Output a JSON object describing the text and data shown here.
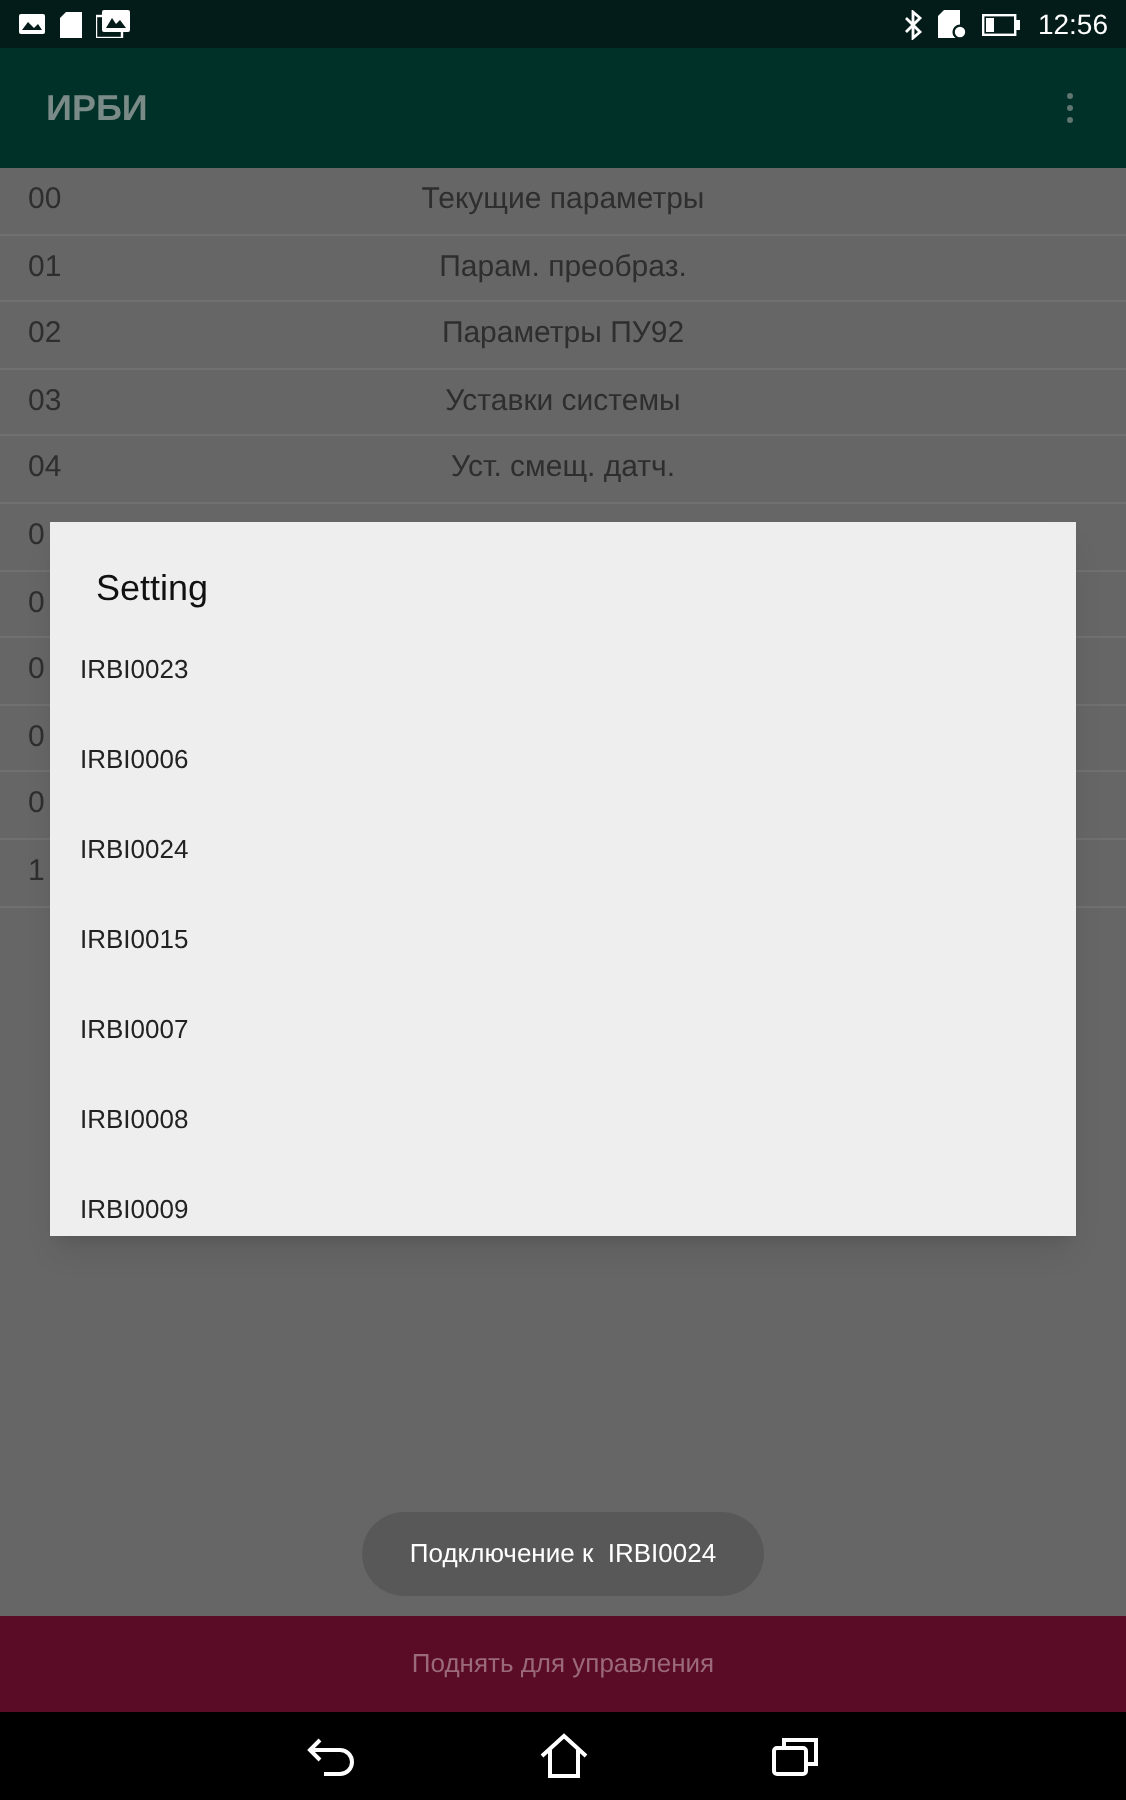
{
  "status_bar": {
    "time": "12:56"
  },
  "app_bar": {
    "title": "ИРБИ"
  },
  "rows": [
    {
      "number": "00",
      "label": "Текущие параметры"
    },
    {
      "number": "01",
      "label": "Парам. преобраз."
    },
    {
      "number": "02",
      "label": "Параметры ПУ92"
    },
    {
      "number": "03",
      "label": "Уставки системы"
    },
    {
      "number": "04",
      "label": "Уст. смещ. датч."
    },
    {
      "number": "0"
    },
    {
      "number": "0"
    },
    {
      "number": "0"
    },
    {
      "number": "0"
    },
    {
      "number": "0"
    },
    {
      "number": "1"
    }
  ],
  "dialog": {
    "title": "Setting",
    "items": [
      "IRBI0023",
      "IRBI0006",
      "IRBI0024",
      "IRBI0015",
      "IRBI0007",
      "IRBI0008",
      "IRBI0009"
    ]
  },
  "toast": "Подключение к  IRBI0024",
  "bottom_bar": {
    "label": "Поднять для управления"
  }
}
